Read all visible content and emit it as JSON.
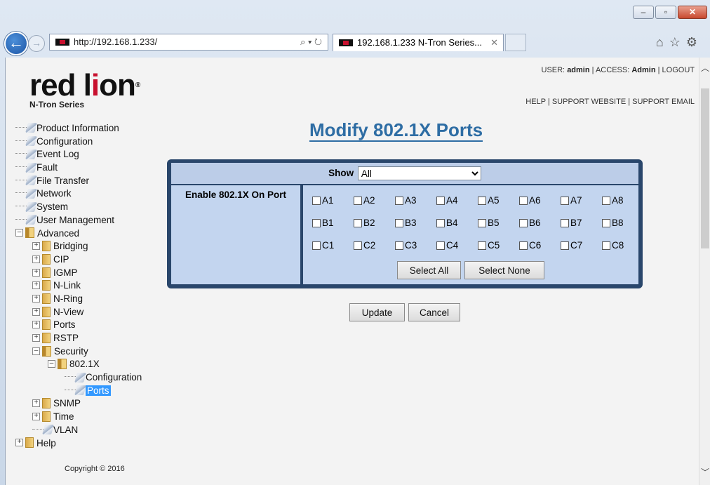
{
  "browser": {
    "url": "http://192.168.1.233/",
    "tab_title": "192.168.1.233 N-Tron Series...",
    "favicon_label": "red lion"
  },
  "header": {
    "logo_text": "red lion",
    "logo_sub": "N-Tron Series",
    "user_label": "USER:",
    "user_value": "admin",
    "access_label": "ACCESS:",
    "access_value": "Admin",
    "logout": "LOGOUT",
    "help": "HELP",
    "support_website": "SUPPORT WEBSITE",
    "support_email": "SUPPORT EMAIL",
    "sep": "|"
  },
  "nav": {
    "product_information": "Product Information",
    "configuration": "Configuration",
    "event_log": "Event Log",
    "fault": "Fault",
    "file_transfer": "File Transfer",
    "network": "Network",
    "system": "System",
    "user_management": "User Management",
    "advanced": "Advanced",
    "bridging": "Bridging",
    "cip": "CIP",
    "igmp": "IGMP",
    "nlink": "N-Link",
    "nring": "N-Ring",
    "nview": "N-View",
    "ports": "Ports",
    "rstp": "RSTP",
    "security": "Security",
    "dot1x": "802.1X",
    "dot1x_configuration": "Configuration",
    "dot1x_ports": "Ports",
    "snmp": "SNMP",
    "time": "Time",
    "vlan": "VLAN",
    "help": "Help"
  },
  "copyright": "Copyright © 2016",
  "main": {
    "title": "Modify 802.1X Ports",
    "show_label": "Show",
    "show_value": "All",
    "enable_label": "Enable 802.1X On Port",
    "ports_a": [
      "A1",
      "A2",
      "A3",
      "A4",
      "A5",
      "A6",
      "A7",
      "A8"
    ],
    "ports_b": [
      "B1",
      "B2",
      "B3",
      "B4",
      "B5",
      "B6",
      "B7",
      "B8"
    ],
    "ports_c": [
      "C1",
      "C2",
      "C3",
      "C4",
      "C5",
      "C6",
      "C7",
      "C8"
    ],
    "select_all": "Select All",
    "select_none": "Select None",
    "update": "Update",
    "cancel": "Cancel"
  }
}
